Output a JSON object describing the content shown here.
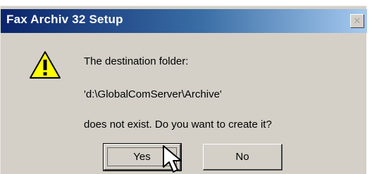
{
  "dialog": {
    "title": "Fax Archiv 32 Setup",
    "close_symbol": "✕",
    "icon": "warning-icon",
    "message_line_1": "The destination folder:",
    "message_line_2": "'d:\\GlobalComServer\\Archive'",
    "message_line_3": "does not exist. Do you want to create it?",
    "yes_label": "Yes",
    "no_label": "No"
  },
  "colors": {
    "titlebar_start": "#0a246a",
    "titlebar_end": "#a6caf0",
    "dialog_face": "#d4d0c8",
    "warning_yellow": "#ffff00"
  }
}
